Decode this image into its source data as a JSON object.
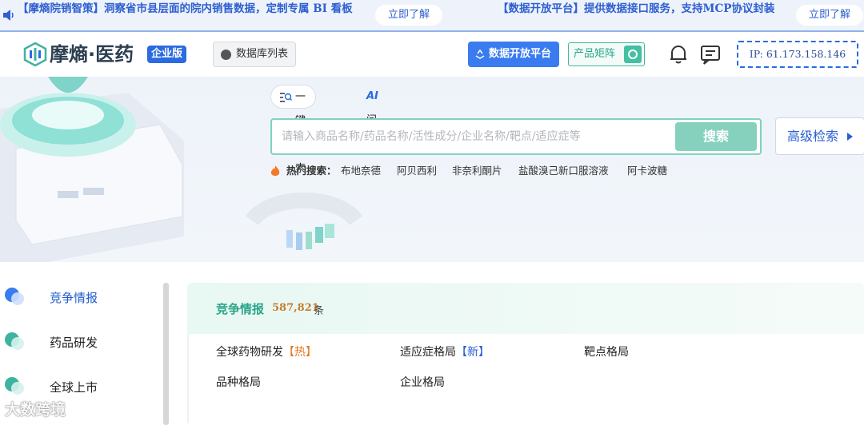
{
  "announcements": [
    {
      "text": "【摩熵院销智策】洞察省市县层面的院内销售数据，定制专属 BI 看板",
      "cta": "立即了解"
    },
    {
      "text": "【数据开放平台】提供数据接口服务，支持MCP协议封装",
      "cta": "立即了解"
    }
  ],
  "header": {
    "logo_text": "摩熵·医药",
    "edition_badge": "企业版",
    "db_list_label": "数据库列表",
    "open_platform_label": "数据开放平台",
    "product_matrix_label": "产品矩阵",
    "ip_label": "IP: 61.173.158.146"
  },
  "search": {
    "tabs": [
      {
        "label": "一键检索",
        "icon": "list-search-icon"
      },
      {
        "label": "问答",
        "icon": "ai-icon",
        "glyph": "AI"
      }
    ],
    "placeholder": "请输入商品名称/药品名称/活性成分/企业名称/靶点/适应症等",
    "button_label": "搜索",
    "advanced_label": "高级检索",
    "hot_label": "热门搜索：",
    "hot_items": [
      "布地奈德",
      "阿贝西利",
      "非奈利酮片",
      "盐酸溴己新口服溶液",
      "阿卡波糖"
    ]
  },
  "sidebar": {
    "items": [
      {
        "label": "竞争情报",
        "active": true
      },
      {
        "label": "药品研发",
        "active": false
      },
      {
        "label": "全球上市",
        "active": false
      }
    ]
  },
  "content": {
    "title": "竞争情报",
    "count": "587,821",
    "unit": "条",
    "modules": [
      {
        "label": "全球药物研发",
        "tag": "【热】",
        "tag_type": "hot"
      },
      {
        "label": "适应症格局",
        "tag": "【新】",
        "tag_type": "new"
      },
      {
        "label": "靶点格局",
        "tag": "",
        "tag_type": ""
      },
      {
        "label": "品种格局",
        "tag": "",
        "tag_type": ""
      },
      {
        "label": "企业格局",
        "tag": "",
        "tag_type": ""
      }
    ]
  },
  "watermark": "大数跨境",
  "colors": {
    "brand_blue": "#2a6be0",
    "brand_green": "#2aa58a",
    "hot_orange": "#e07a1f"
  }
}
